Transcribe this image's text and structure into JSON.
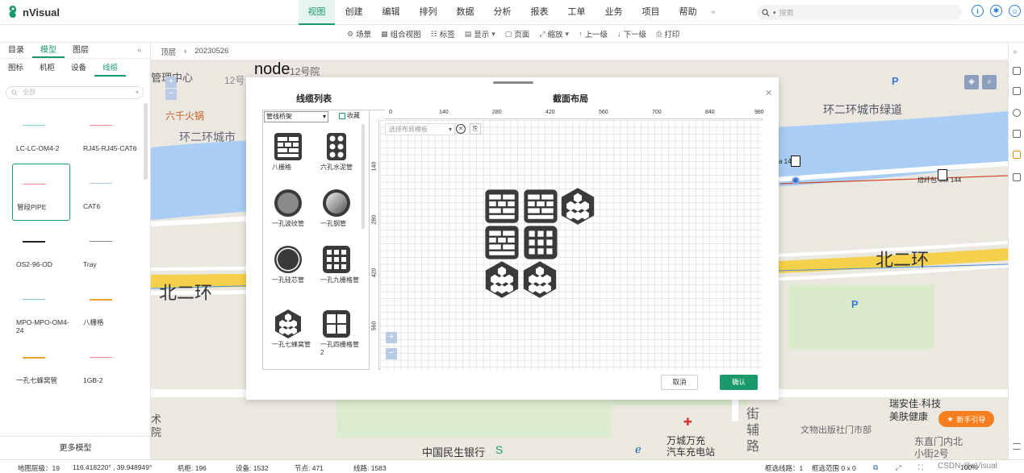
{
  "app": {
    "name": "nVisual"
  },
  "menu": [
    "视图",
    "创建",
    "编辑",
    "排列",
    "数据",
    "分析",
    "报表",
    "工单",
    "业务",
    "项目",
    "帮助"
  ],
  "search": {
    "placeholder": "搜索"
  },
  "toolbar": [
    "场景",
    "组合视图",
    "标签",
    "显示",
    "页面",
    "缩放",
    "上一级",
    "下一级",
    "打印"
  ],
  "left_panel": {
    "tabs": [
      "目录",
      "模型",
      "图层"
    ],
    "subtabs": [
      "图标",
      "机柜",
      "设备",
      "线缆"
    ],
    "search_placeholder": "全部",
    "models": [
      {
        "label": "LC-LC-OM4-2",
        "color": "#7fd6c4"
      },
      {
        "label": "RJ45-RJ45-CAT6",
        "color": "#f08a82"
      },
      {
        "label": "管段PIPE",
        "color": "#f08a82"
      },
      {
        "label": "CAT6",
        "color": "#9fd2e8"
      },
      {
        "label": "OS2-96-OD",
        "color": "#222222"
      },
      {
        "label": "Tray",
        "color": "#888888"
      },
      {
        "label": "MPO-MPO-OM4-24",
        "color": "#7fc2d8"
      },
      {
        "label": "八栅格",
        "color": "#f2a830"
      },
      {
        "label": "一孔七蜂窝管",
        "color": "#f2a830"
      },
      {
        "label": "1GB-2",
        "color": "#f08a82"
      }
    ],
    "more": "更多模型"
  },
  "breadcrumb": {
    "root": "顶层",
    "current": "20230526"
  },
  "map_labels": {
    "node": "node",
    "hospital": "-12号院",
    "ring_road_1": "环二环城市绿道",
    "ring_road_2": "环二环城市",
    "beierhuan_1": "北二环",
    "beierhuan_2": "北二环",
    "bank": "中国民生银行",
    "charging": "万城万充\n汽车充电站",
    "building": "瑞安佳·科技\n美肤健康",
    "museum": "文物出版社门市部",
    "street": "东直门内北\n小街2号",
    "road_v": "街\n辅\n路",
    "hotpot": "六千火锅",
    "site": "焙纤包 site 144",
    "site2": "a 144",
    "top_left": "管理中心",
    "top_left2": "术\n院",
    "top_num": "12号"
  },
  "modal": {
    "cable_list_title": "线缆列表",
    "section_layout_title": "截面布局",
    "category": "管线桥架",
    "favorite": "收藏",
    "layout_template_placeholder": "选择布局模板",
    "cancel": "取消",
    "confirm": "确认",
    "items": [
      "八栅格",
      "六孔水泥管",
      "一孔波纹管",
      "一孔钢管",
      "一孔硅芯管",
      "一孔九栅格管",
      "一孔七蜂窝管",
      "一孔四栅格管2"
    ],
    "h_ruler": [
      "0",
      "140",
      "280",
      "420",
      "560",
      "700",
      "840",
      "980"
    ],
    "v_ruler": [
      "140",
      "280",
      "420",
      "560"
    ]
  },
  "status": {
    "level": "地图层级：19",
    "coords": "116.418220° , 39.948949°",
    "racks": "机柜: 196",
    "devices": "设备: 1532",
    "nodes": "节点: 471",
    "lines": "线路: 1583",
    "selected_lines": "框选线路：1",
    "selected_range": "框选范围 0 x 0",
    "zoom": "100%",
    "watermark": "CSDN @nVisual"
  },
  "guide": "新手引导"
}
